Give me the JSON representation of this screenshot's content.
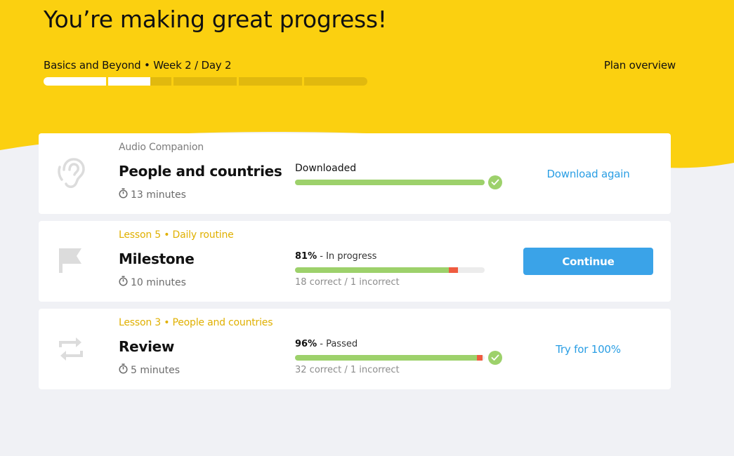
{
  "colors": {
    "hero": "#fbd010",
    "background": "#f0f1f5",
    "accent_blue": "#3aa3e8",
    "progress_good": "#9dd16b",
    "progress_bad": "#ef5b3f",
    "eyebrow_gold": "#e0b000"
  },
  "header": {
    "title": "You’re making great progress!",
    "plan_label": "Basics and Beyond • Week 2 / Day 2",
    "plan_overview_link": "Plan overview",
    "week_progress": {
      "segments_total": 5,
      "segments_completed": 1,
      "current_segment_fraction": 0.67
    }
  },
  "cards": [
    {
      "icon": "ear-icon",
      "eyebrow": "Audio Companion",
      "title": "People and countries",
      "duration": "13 minutes",
      "status_label": "Downloaded",
      "progress_correct_fraction": 1.0,
      "progress_incorrect_fraction": 0,
      "completed": true,
      "action": "Download again"
    },
    {
      "icon": "flag-icon",
      "eyebrow": "Lesson 5 • Daily routine",
      "title": "Milestone",
      "duration": "10 minutes",
      "status_pct": "81%",
      "status_text": " - In progress",
      "score": "18 correct / 1 incorrect",
      "progress_correct_fraction": 0.81,
      "progress_incorrect_fraction": 0.05,
      "completed": false,
      "action": "Continue"
    },
    {
      "icon": "repeat-icon",
      "eyebrow": "Lesson 3 • People and countries",
      "title": "Review",
      "duration": "5 minutes",
      "status_pct": "96%",
      "status_text": " - Passed",
      "score": "32 correct / 1 incorrect",
      "progress_correct_fraction": 0.96,
      "progress_incorrect_fraction": 0.03,
      "completed": true,
      "action": "Try for 100%"
    }
  ]
}
